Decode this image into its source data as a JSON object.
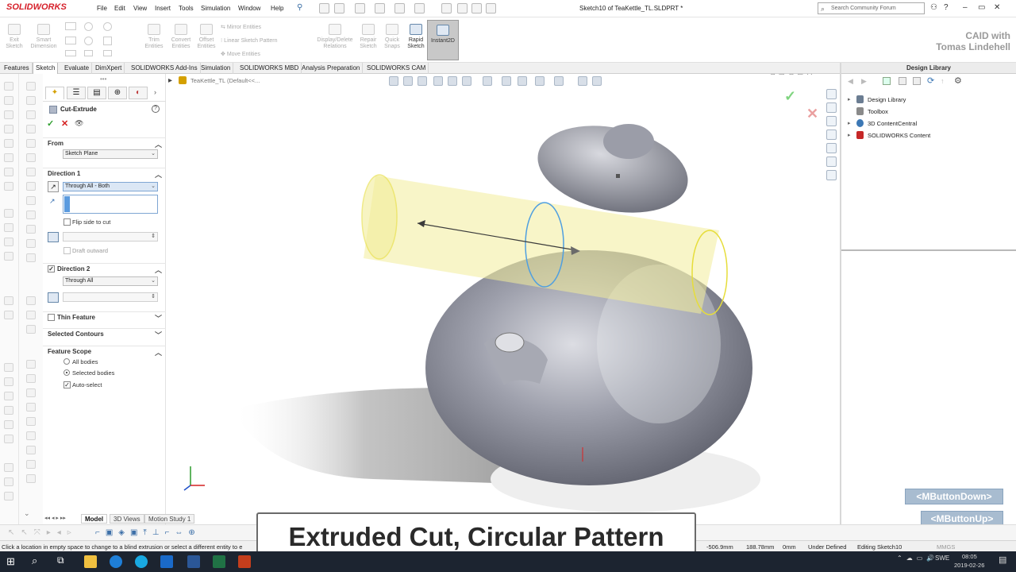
{
  "app": {
    "logo": "SOLIDWORKS",
    "menus": [
      "File",
      "Edit",
      "View",
      "Insert",
      "Tools",
      "Simulation",
      "Window",
      "Help"
    ],
    "title": "Sketch10 of TeaKettle_TL.SLDPRT *",
    "search_placeholder": "Search Community Forum"
  },
  "ribbon": {
    "exit_sketch": "Exit Sketch",
    "smart_dimension": "Smart Dimension",
    "trim_entities": "Trim Entities",
    "convert_entities": "Convert Entities",
    "offset_entities": "Offset Entities",
    "mirror_entities": "Mirror Entities",
    "linear_sketch_pattern": "Linear Sketch Pattern",
    "move_entities": "Move Entities",
    "display_delete_relations": "Display/Delete Relations",
    "repair_sketch": "Repair Sketch",
    "quick_snaps": "Quick Snaps",
    "rapid_sketch": "Rapid Sketch",
    "instant2d": "Instant2D"
  },
  "brand": {
    "line1": "CAID with",
    "line2": "Tomas Lindehell"
  },
  "command_tabs": [
    "Features",
    "Sketch",
    "Evaluate",
    "DimXpert",
    "SOLIDWORKS Add-Ins",
    "Simulation",
    "SOLIDWORKS MBD",
    "Analysis Preparation",
    "SOLIDWORKS CAM"
  ],
  "active_tab": "Sketch",
  "property_manager": {
    "title": "Cut-Extrude",
    "from_label": "From",
    "from_value": "Sketch Plane",
    "direction1_label": "Direction 1",
    "direction1_value": "Through All - Both",
    "flip_side_label": "Flip side to cut",
    "draft_outward_label": "Draft outward",
    "direction2_label": "Direction 2",
    "direction2_value": "Through All",
    "thin_feature_label": "Thin Feature",
    "selected_contours_label": "Selected Contours",
    "feature_scope_label": "Feature Scope",
    "all_bodies_label": "All bodies",
    "selected_bodies_label": "Selected bodies",
    "auto_select_label": "Auto-select"
  },
  "tree": {
    "root": "TeaKettle_TL  (Default<<..."
  },
  "design_library": {
    "header": "Design Library",
    "items": [
      {
        "label": "Design Library",
        "icon": "library-icon",
        "color": "#6b7d92"
      },
      {
        "label": "Toolbox",
        "icon": "toolbox-icon",
        "color": "#8a8a8a"
      },
      {
        "label": "3D ContentCentral",
        "icon": "globe-icon",
        "color": "#3c78b5"
      },
      {
        "label": "SOLIDWORKS Content",
        "icon": "content-icon",
        "color": "#c62828"
      }
    ]
  },
  "mouse_buttons": {
    "down": "<MButtonDown>",
    "up": "<MButtonUp>"
  },
  "bottom_tabs": [
    "Model",
    "3D Views",
    "Motion Study 1"
  ],
  "status": {
    "message": "Click a location in empty space to change to a blind extrusion or select a different entity to e",
    "x": "-506.9mm",
    "y": "188.78mm",
    "z": "0mm",
    "state": "Under Defined",
    "editing": "Editing Sketch10",
    "units": "MMGS"
  },
  "caption": "Extruded Cut, Circular Pattern",
  "taskbar": {
    "lang": "SWE",
    "time": "08:05",
    "date": "2019-02-26"
  },
  "colors": {
    "accent": "#d6202a",
    "extrude_preview": "#f3ed9a",
    "sketch_circle": "#4f9fe0",
    "body": "#7f8190"
  }
}
